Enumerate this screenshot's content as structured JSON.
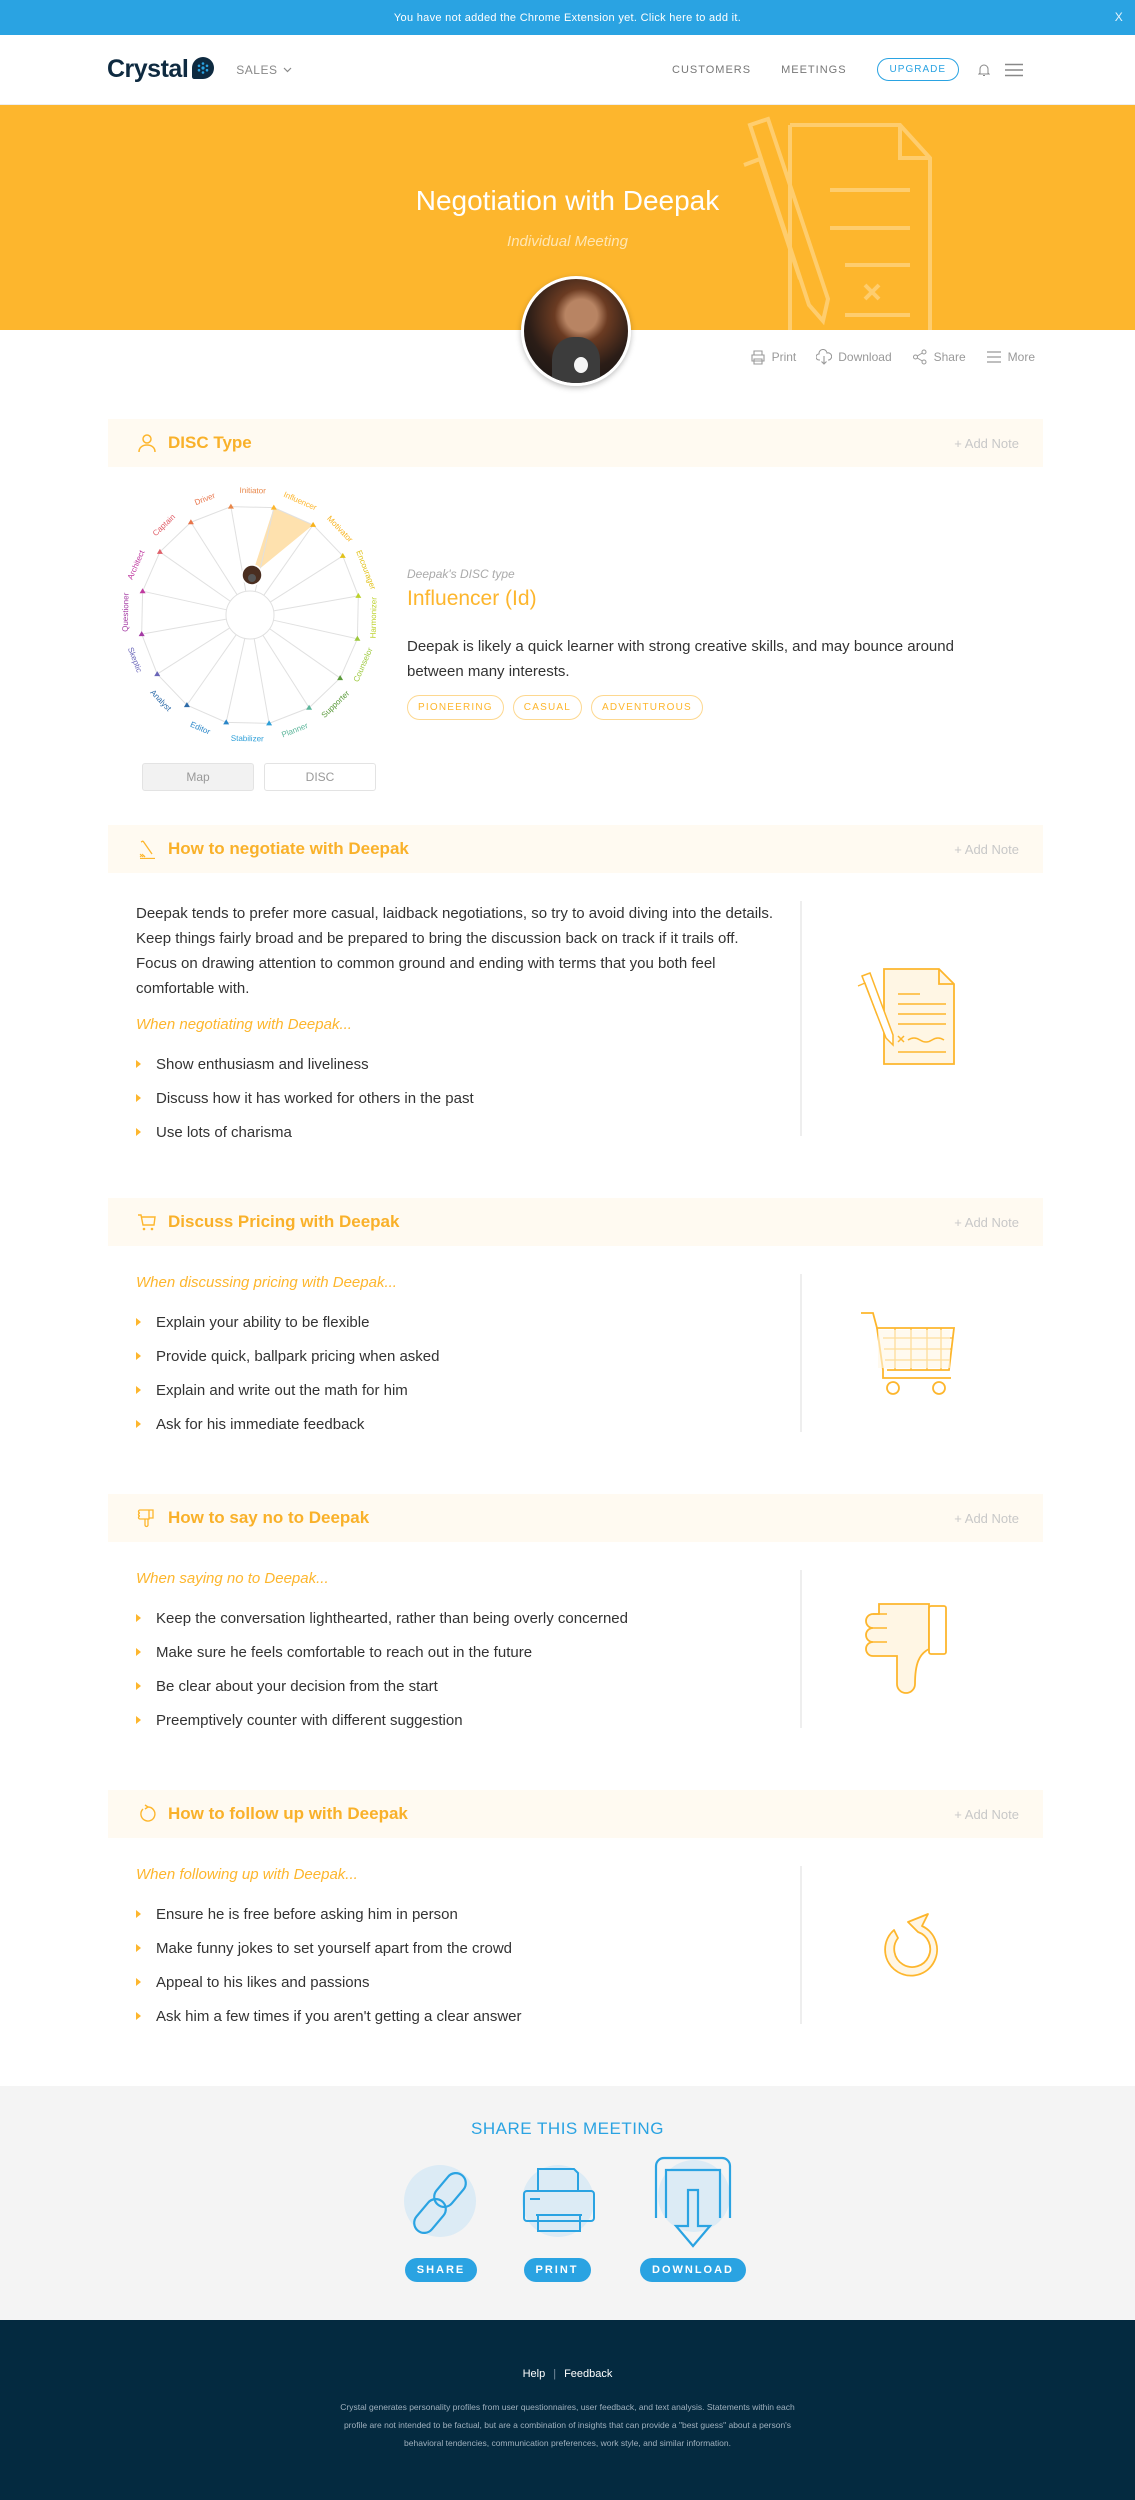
{
  "banner": {
    "text": "You have not added the Chrome Extension yet. Click here to add it.",
    "close_label": "X"
  },
  "nav": {
    "brand": "Crystal",
    "workspace": "SALES",
    "links": [
      "CUSTOMERS",
      "MEETINGS"
    ],
    "upgrade": "UPGRADE"
  },
  "hero": {
    "title": "Negotiation with Deepak",
    "subtitle": "Individual Meeting",
    "background_color": "#fdb62d"
  },
  "actions": [
    {
      "label": "Print",
      "icon": "printer-icon"
    },
    {
      "label": "Download",
      "icon": "cloud-download-icon"
    },
    {
      "label": "Share",
      "icon": "share-icon"
    },
    {
      "label": "More",
      "icon": "menu-icon"
    }
  ],
  "add_note_label": "+ Add Note",
  "disc": {
    "title": "DISC Type",
    "caption": "Deepak's DISC type",
    "type": "Influencer (Id)",
    "description": "Deepak is likely a quick learner with strong creative skills, and may bounce around between many interests.",
    "tags": [
      "PIONEERING",
      "CASUAL",
      "ADVENTUROUS"
    ],
    "toggle": [
      "Map",
      "DISC"
    ],
    "active_toggle": "Map",
    "wheel_labels": [
      {
        "label": "Initiator",
        "color": "#e8874a"
      },
      {
        "label": "Influencer",
        "color": "#fdb62d"
      },
      {
        "label": "Motivator",
        "color": "#f8b21a"
      },
      {
        "label": "Encourager",
        "color": "#e2c21a"
      },
      {
        "label": "Harmonizer",
        "color": "#bdd22c"
      },
      {
        "label": "Counselor",
        "color": "#9cc83a"
      },
      {
        "label": "Supporter",
        "color": "#5a9a3a"
      },
      {
        "label": "Planner",
        "color": "#5bb59a"
      },
      {
        "label": "Stabilizer",
        "color": "#2e9fd8"
      },
      {
        "label": "Editor",
        "color": "#2a86c8"
      },
      {
        "label": "Analyst",
        "color": "#2c6aa8"
      },
      {
        "label": "Skeptic",
        "color": "#6a66b8"
      },
      {
        "label": "Questioner",
        "color": "#a43aa4"
      },
      {
        "label": "Architect",
        "color": "#c03aa0"
      },
      {
        "label": "Captain",
        "color": "#e0606a"
      },
      {
        "label": "Driver",
        "color": "#e8744a"
      }
    ],
    "highlighted_label": "Influencer"
  },
  "negotiate": {
    "title": "How to negotiate with Deepak",
    "paragraph": "Deepak tends to prefer more casual, laidback negotiations, so try to avoid diving into the details. Keep things fairly broad and be prepared to bring the discussion back on track if it trails off. Focus on drawing attention to common ground and ending with terms that you both feel comfortable with.",
    "lead": "When negotiating with Deepak...",
    "tips": [
      "Show enthusiasm and liveliness",
      "Discuss how it has worked for others in the past",
      "Use lots of charisma"
    ]
  },
  "pricing": {
    "title": "Discuss Pricing with Deepak",
    "lead": "When discussing pricing with Deepak...",
    "tips": [
      "Explain your ability to be flexible",
      "Provide quick, ballpark pricing when asked",
      "Explain and write out the math for him",
      "Ask for his immediate feedback"
    ]
  },
  "say_no": {
    "title": "How to say no to Deepak",
    "lead": "When saying no to Deepak...",
    "tips": [
      "Keep the conversation lighthearted, rather than being overly concerned",
      "Make sure he feels comfortable to reach out in the future",
      "Be clear about your decision from the start",
      "Preemptively counter with different suggestion"
    ]
  },
  "follow_up": {
    "title": "How to follow up with Deepak",
    "lead": "When following up with Deepak...",
    "tips": [
      "Ensure he is free before asking him in person",
      "Make funny jokes to set yourself apart from the crowd",
      "Appeal to his likes and passions",
      "Ask him a few times if you aren't getting a clear answer"
    ]
  },
  "share": {
    "title": "SHARE THIS MEETING",
    "buttons": [
      "SHARE",
      "PRINT",
      "DOWNLOAD"
    ],
    "accent_color": "#2aa3e2"
  },
  "footer": {
    "links": [
      "Help",
      "Feedback"
    ],
    "disclaimer": "Crystal generates personality profiles from user questionnaires, user feedback, and text analysis. Statements within each profile are not intended to be factual, but are a combination of insights that can provide a \"best guess\" about a person's behavioral tendencies, communication preferences, work style, and similar information."
  }
}
